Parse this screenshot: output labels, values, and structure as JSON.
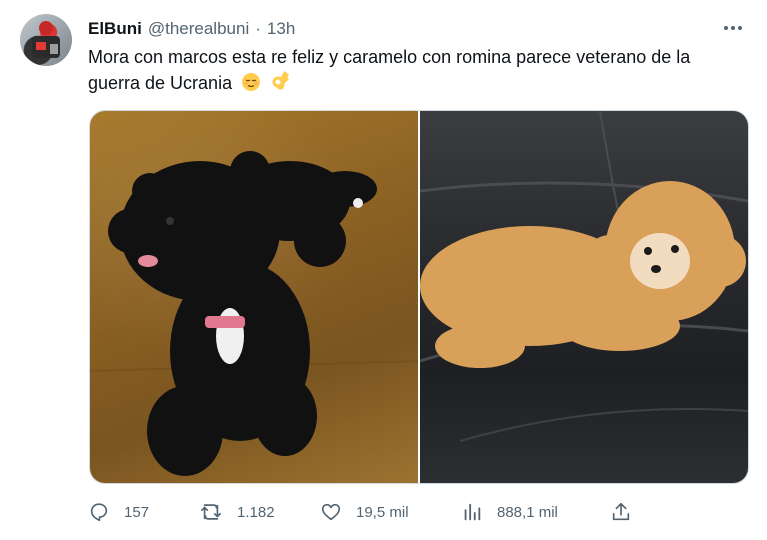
{
  "tweet": {
    "display_name": "ElBuni",
    "handle": "@therealbuni",
    "separator": "·",
    "time": "13h",
    "text": "Mora con marcos esta re feliz y caramelo con romina parece veterano de la guerra de Ucrania",
    "emojis": [
      "relieved-face-icon",
      "ok-hand-icon"
    ]
  },
  "media": {
    "images": [
      "black-poodle-puppy-photo",
      "golden-poodle-on-black-sofa-photo"
    ]
  },
  "actions": {
    "replies": "157",
    "retweets": "1.182",
    "likes": "19,5 mil",
    "views": "888,1 mil"
  },
  "colors": {
    "text_primary": "#0f1419",
    "text_secondary": "#536471",
    "border": "#cfd9de"
  }
}
